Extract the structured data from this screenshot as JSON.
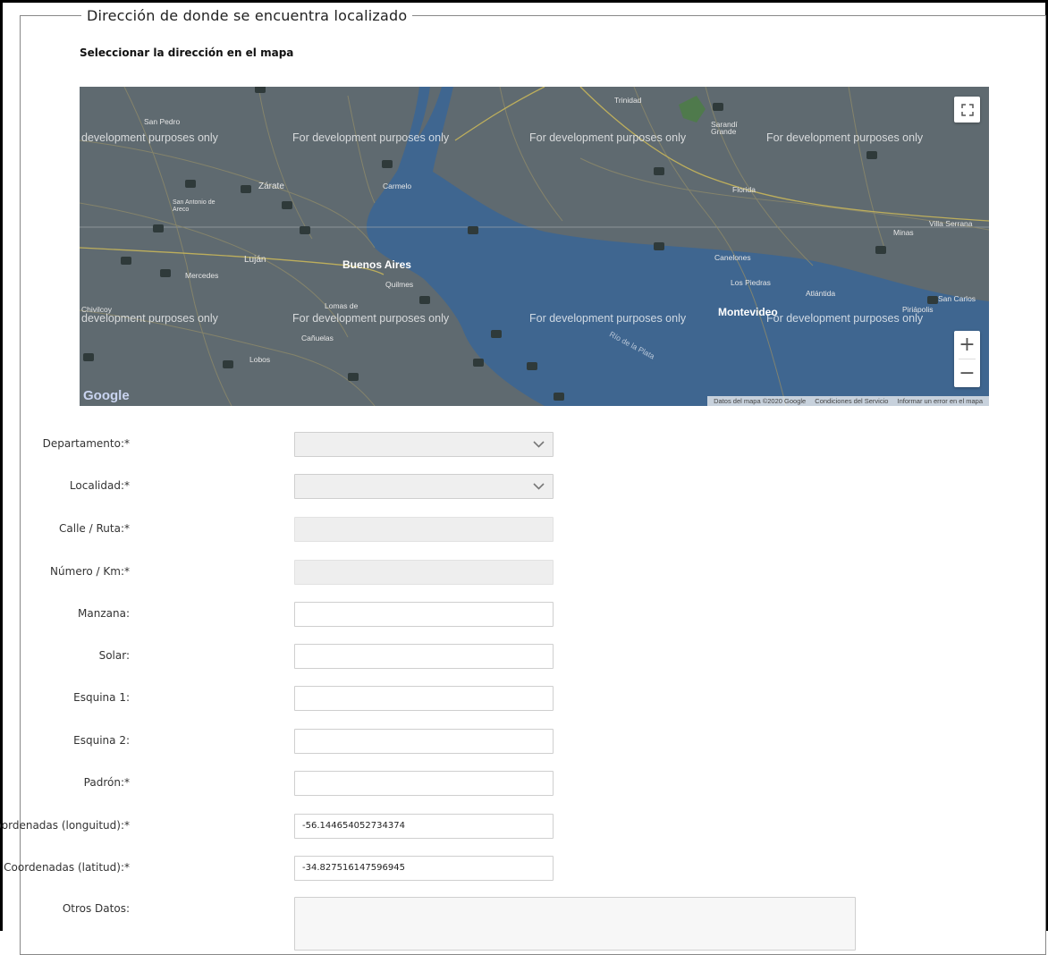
{
  "section": {
    "legend": "Dirección de donde se encuentra localizado",
    "subtitle": "Seleccionar la dirección en el mapa"
  },
  "map": {
    "watermark": "For development purposes only",
    "watermark_partial": "development purposes only",
    "cities_major": [
      "Buenos Aires",
      "Montevideo"
    ],
    "cities_minor": [
      "San Pedro",
      "Zárate",
      "San Antonio de Areco",
      "Luján",
      "Mercedes",
      "Chivilcoy",
      "Lobos",
      "Cañuelas",
      "Lomas de",
      "Quilmes",
      "Carmelo",
      "Trinidad",
      "Sarandí Grande",
      "Florida",
      "Canelones",
      "Los Piedras",
      "Atlántida",
      "San Carlos",
      "Minas",
      "Villa Serrana",
      "Piriápolis",
      "Río de la Plata"
    ],
    "attribution": [
      "Datos del mapa ©2020 Google",
      "Condiciones del Servicio",
      "Informar un error en el mapa"
    ],
    "logo": "Google",
    "zoom_in": "+",
    "zoom_out": "−",
    "water_color": "#3f6690",
    "land_color": "#5f6a70"
  },
  "form": {
    "departamento": {
      "label": "Departamento:*",
      "value": ""
    },
    "localidad": {
      "label": "Localidad:*",
      "value": ""
    },
    "calle": {
      "label": "Calle / Ruta:*",
      "value": ""
    },
    "numero": {
      "label": "Número / Km:*",
      "value": ""
    },
    "manzana": {
      "label": "Manzana:",
      "value": ""
    },
    "solar": {
      "label": "Solar:",
      "value": ""
    },
    "esquina1": {
      "label": "Esquina 1:",
      "value": ""
    },
    "esquina2": {
      "label": "Esquina 2:",
      "value": ""
    },
    "padron": {
      "label": "Padrón:*",
      "value": ""
    },
    "longitud": {
      "label": "Coordenadas (longuitud):*",
      "value": "-56.144654052734374"
    },
    "latitud": {
      "label": "Coordenadas (latitud):*",
      "value": "-34.827516147596945"
    },
    "otros": {
      "label": "Otros Datos:",
      "value": ""
    }
  }
}
